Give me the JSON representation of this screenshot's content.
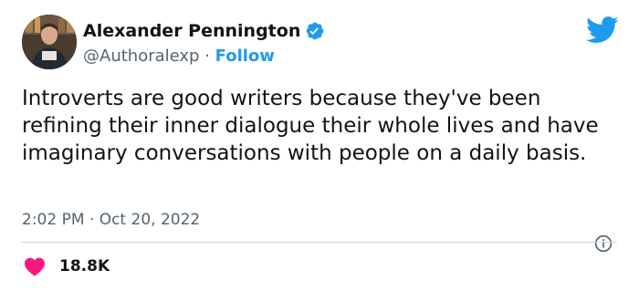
{
  "author": {
    "name": "Alexander Pennington",
    "handle": "@Authoralexp",
    "separator": " · ",
    "follow_label": "Follow",
    "verified": true
  },
  "tweet": {
    "text": "Introverts are good writers because they've been refining their inner dialogue their whole lives and have imaginary conversations with people on a daily basis.",
    "timestamp": "2:02 PM · Oct 20, 2022"
  },
  "engagement": {
    "like_count": "18.8K"
  },
  "colors": {
    "accent": "#1d9bf0",
    "like": "#f91880",
    "secondary_text": "#536471",
    "primary_text": "#0f1419",
    "divider": "#cfd9de"
  },
  "icons": {
    "platform": "twitter-bird-icon",
    "verified": "verified-badge-icon",
    "info": "info-icon",
    "like": "heart-icon"
  }
}
